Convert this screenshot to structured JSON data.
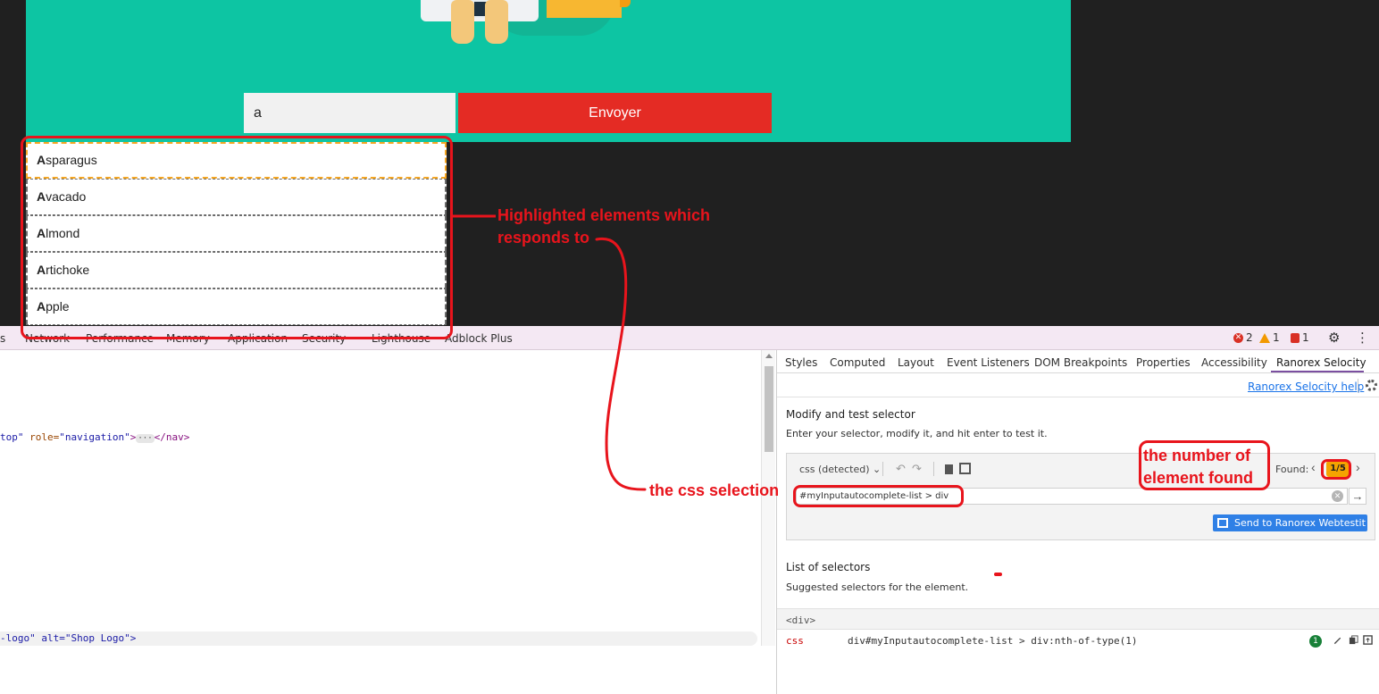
{
  "page": {
    "search_value": "a",
    "send_label": "Envoyer",
    "autocomplete": [
      {
        "match": "A",
        "rest": "sparagus"
      },
      {
        "match": "A",
        "rest": "vacado"
      },
      {
        "match": "A",
        "rest": "lmond"
      },
      {
        "match": "A",
        "rest": "rtichoke"
      },
      {
        "match": "A",
        "rest": "pple"
      }
    ]
  },
  "devtools": {
    "tabs": [
      "s",
      "Network",
      "Performance",
      "Memory",
      "Application",
      "Security",
      "Lighthouse",
      "Adblock Plus"
    ],
    "status": {
      "errors": "2",
      "warnings": "1",
      "issues": "1"
    },
    "code_lines": {
      "nav_attr1": "top\"",
      "nav_attr2": " role=",
      "nav_val2": "\"navigation\"",
      "nav_tail": "</nav>",
      "logo_line": "-logo\" alt=\"Shop Logo\">"
    },
    "side_tabs": [
      "Styles",
      "Computed",
      "Layout",
      "Event Listeners",
      "DOM Breakpoints",
      "Properties",
      "Accessibility",
      "Ranorex Selocity"
    ],
    "help_link": "Ranorex Selocity help",
    "modify_title": "Modify and test selector",
    "modify_sub": "Enter your selector, modify it, and hit enter to test it.",
    "selector_type": "css (detected)",
    "found_label": "Found:",
    "found_value": "1/5",
    "selector_value": "#myInputautocomplete-list > div",
    "webtestit_label": "Send to Ranorex Webtestit",
    "list_title": "List of selectors",
    "list_sub": "Suggested selectors for the element.",
    "list_header": "<div>",
    "selectors": [
      {
        "kind": "css",
        "value": "div#myInputautocomplete-list > div:nth-of-type(1)",
        "count": "1"
      }
    ]
  },
  "annotations": {
    "highlight_line1": "Highlighted elements which",
    "highlight_line2": "responds to",
    "css_selection": "the css selection",
    "found_line1": "the number of",
    "found_line2": "element found"
  },
  "colors": {
    "accent_red": "#e8141c",
    "hero": "#0dc5a3",
    "button": "#e42b24",
    "badge": "#f5a300"
  }
}
